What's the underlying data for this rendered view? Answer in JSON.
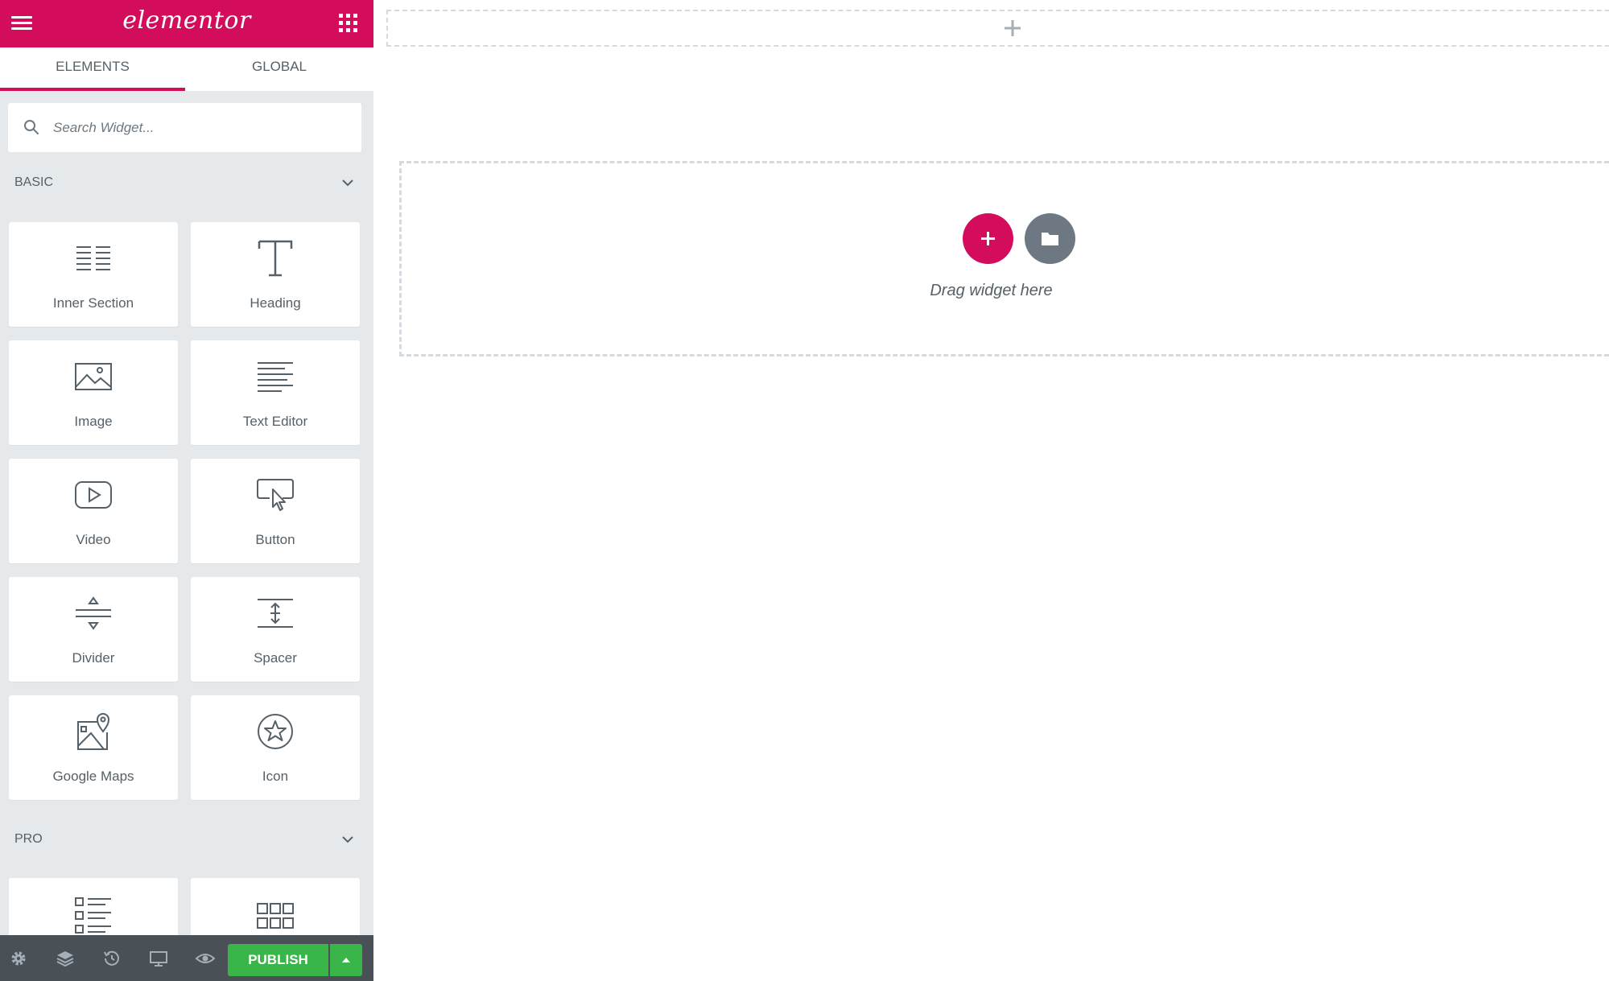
{
  "header": {
    "logo": "elementor",
    "menu_icon": "hamburger-icon",
    "apps_icon": "grid-apps-icon",
    "brand_color": "#d30c5c"
  },
  "tabs": [
    {
      "label": "ELEMENTS",
      "active": true
    },
    {
      "label": "GLOBAL",
      "active": false
    }
  ],
  "search": {
    "placeholder": "Search Widget...",
    "value": "",
    "icon": "search-icon"
  },
  "categories": [
    {
      "title": "BASIC",
      "widgets": [
        {
          "label": "Inner Section",
          "icon": "inner-section-icon"
        },
        {
          "label": "Heading",
          "icon": "heading-icon"
        },
        {
          "label": "Image",
          "icon": "image-icon"
        },
        {
          "label": "Text Editor",
          "icon": "text-editor-icon"
        },
        {
          "label": "Video",
          "icon": "video-icon"
        },
        {
          "label": "Button",
          "icon": "button-icon"
        },
        {
          "label": "Divider",
          "icon": "divider-icon"
        },
        {
          "label": "Spacer",
          "icon": "spacer-icon"
        },
        {
          "label": "Google Maps",
          "icon": "google-maps-icon"
        },
        {
          "label": "Icon",
          "icon": "star-icon"
        }
      ]
    },
    {
      "title": "PRO",
      "widgets": [
        {
          "label": "",
          "icon": "posts-icon"
        },
        {
          "label": "",
          "icon": "portfolio-icon"
        }
      ]
    }
  ],
  "footer": {
    "icons": [
      "settings-icon",
      "navigator-icon",
      "history-icon",
      "responsive-icon",
      "preview-icon"
    ],
    "publish_label": "PUBLISH",
    "publish_color": "#39b54a"
  },
  "canvas": {
    "drop_text": "Drag widget here",
    "add_button_color": "#d30c5c",
    "template_button_color": "#6d7882"
  }
}
